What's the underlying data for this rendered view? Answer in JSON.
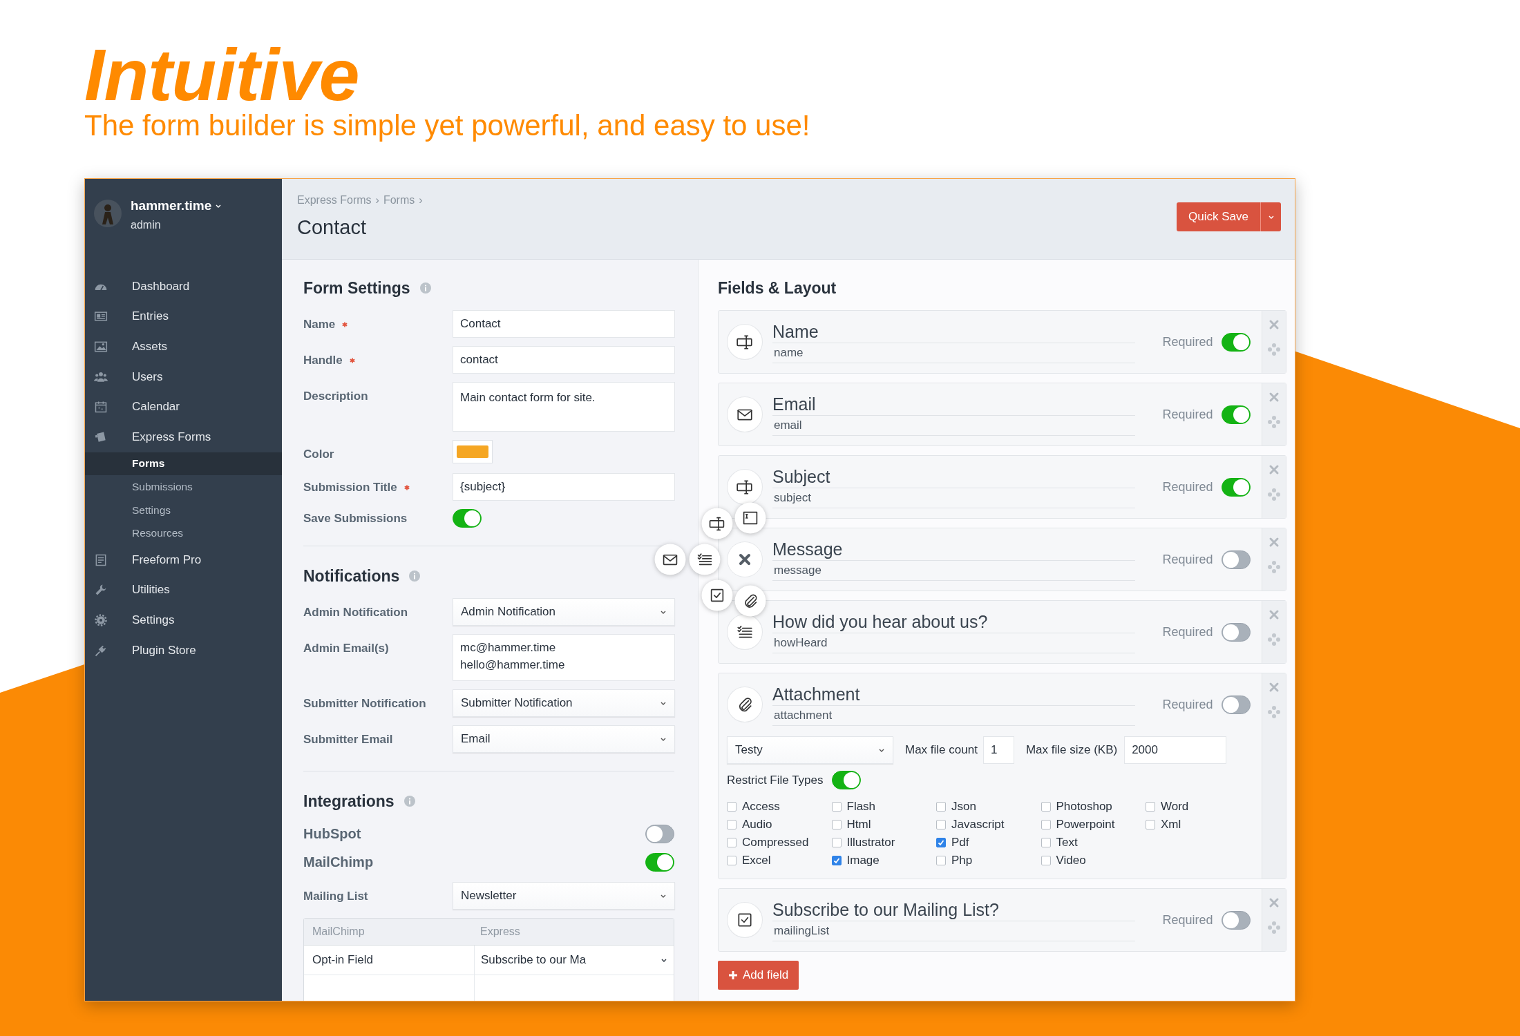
{
  "headline": {
    "title": "Intuitive",
    "subtitle": "The form builder is simple yet powerful, and easy to use!"
  },
  "sidebar": {
    "user": {
      "name": "hammer.time",
      "role": "admin"
    },
    "items": [
      {
        "label": "Dashboard",
        "selected": false
      },
      {
        "label": "Entries",
        "selected": false
      },
      {
        "label": "Assets",
        "selected": false
      },
      {
        "label": "Users",
        "selected": false
      },
      {
        "label": "Calendar",
        "selected": false
      },
      {
        "label": "Express Forms",
        "selected": false,
        "children": [
          {
            "label": "Forms",
            "selected": true
          },
          {
            "label": "Submissions",
            "selected": false
          },
          {
            "label": "Settings",
            "selected": false
          },
          {
            "label": "Resources",
            "selected": false
          }
        ]
      },
      {
        "label": "Freeform Pro",
        "selected": false
      },
      {
        "label": "Utilities",
        "selected": false
      },
      {
        "label": "Settings",
        "selected": false
      },
      {
        "label": "Plugin Store",
        "selected": false
      }
    ]
  },
  "header": {
    "breadcrumbs": [
      "Express Forms",
      "Forms"
    ],
    "separator": "›",
    "title": "Contact",
    "save_button": "Quick Save"
  },
  "form_settings": {
    "title": "Form Settings",
    "rows": [
      {
        "kind": "text",
        "label": "Name",
        "required": true,
        "value": "Contact"
      },
      {
        "kind": "text",
        "label": "Handle",
        "required": true,
        "value": "contact"
      },
      {
        "kind": "textarea",
        "label": "Description",
        "value": "Main contact form for site."
      },
      {
        "kind": "color",
        "label": "Color",
        "color": "#f5a623"
      },
      {
        "kind": "text",
        "label": "Submission Title",
        "required": true,
        "value": "{subject}"
      },
      {
        "kind": "toggle",
        "label": "Save Submissions",
        "on": true
      }
    ]
  },
  "notifications": {
    "title": "Notifications",
    "rows": [
      {
        "kind": "select",
        "label": "Admin Notification",
        "value": "Admin Notification"
      },
      {
        "kind": "textarea",
        "label": "Admin Email(s)",
        "value": "mc@hammer.time\nhello@hammer.time"
      },
      {
        "kind": "select",
        "label": "Submitter Notification",
        "value": "Submitter Notification"
      },
      {
        "kind": "select",
        "label": "Submitter Email",
        "value": "Email"
      }
    ]
  },
  "integrations": {
    "title": "Integrations",
    "toggles": [
      {
        "label": "HubSpot",
        "on": false
      },
      {
        "label": "MailChimp",
        "on": true
      }
    ],
    "mailing_list": {
      "label": "Mailing List",
      "value": "Newsletter"
    },
    "mapping_table": {
      "columns": [
        "MailChimp",
        "Express"
      ],
      "rows": [
        {
          "field": "Opt-in Field",
          "value": "Subscribe to our Ma"
        }
      ]
    }
  },
  "fields_layout": {
    "title": "Fields & Layout",
    "fields": [
      {
        "kind": "text",
        "label": "Name",
        "handle": "name",
        "required_label": "Required",
        "required": true,
        "menu_open": false
      },
      {
        "kind": "email",
        "label": "Email",
        "handle": "email",
        "required_label": "Required",
        "required": true,
        "menu_open": false
      },
      {
        "kind": "text",
        "label": "Subject",
        "handle": "subject",
        "required_label": "Required",
        "required": true,
        "menu_open": false
      },
      {
        "kind": "textarea",
        "label": "Message",
        "handle": "message",
        "required_label": "Required",
        "required": false,
        "menu_open": true
      },
      {
        "kind": "select",
        "label": "How did you hear about us?",
        "handle": "howHeard",
        "required_label": "Required",
        "required": false,
        "menu_open": false
      },
      {
        "kind": "file",
        "label": "Attachment",
        "handle": "attachment",
        "required_label": "Required",
        "required": false,
        "menu_open": false,
        "asset_source": "Testy",
        "max_count_label": "Max file count",
        "max_count": "1",
        "max_size_label": "Max file size (KB)",
        "max_size": "2000",
        "restrict": {
          "label": "Restrict File Types",
          "on": true
        },
        "file_types": [
          {
            "label": "Access",
            "checked": false
          },
          {
            "label": "Audio",
            "checked": false
          },
          {
            "label": "Compressed",
            "checked": false
          },
          {
            "label": "Excel",
            "checked": false
          },
          {
            "label": "Flash",
            "checked": false
          },
          {
            "label": "Html",
            "checked": false
          },
          {
            "label": "Illustrator",
            "checked": false
          },
          {
            "label": "Image",
            "checked": true
          },
          {
            "label": "Json",
            "checked": false
          },
          {
            "label": "Javascript",
            "checked": false
          },
          {
            "label": "Pdf",
            "checked": true
          },
          {
            "label": "Php",
            "checked": false
          },
          {
            "label": "Photoshop",
            "checked": false
          },
          {
            "label": "Powerpoint",
            "checked": false
          },
          {
            "label": "Text",
            "checked": false
          },
          {
            "label": "Video",
            "checked": false
          },
          {
            "label": "Word",
            "checked": false
          },
          {
            "label": "Xml",
            "checked": false
          }
        ]
      },
      {
        "kind": "checkbox",
        "label": "Subscribe to our Mailing List?",
        "handle": "mailingList",
        "required_label": "Required",
        "required": false,
        "menu_open": false
      }
    ],
    "add_button": "Add field"
  }
}
